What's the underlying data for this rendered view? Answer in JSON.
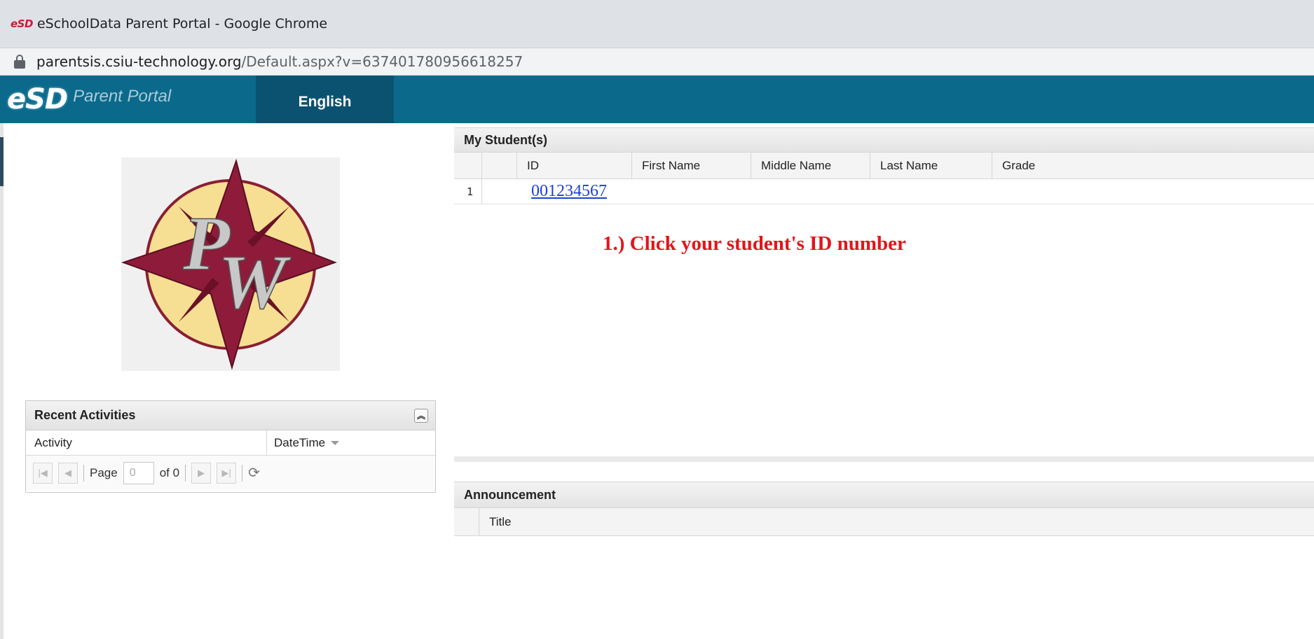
{
  "window": {
    "title_logo": "eSD",
    "title": "eSchoolData Parent Portal - Google Chrome",
    "url_host": "parentsis.csiu-technology.org",
    "url_path": "/Default.aspx?v=637401780956618257"
  },
  "header": {
    "brand_short": "eSD",
    "brand_name": "Parent Portal",
    "language": "English",
    "header_color": "#0b6a8c"
  },
  "logo": {
    "letters": "PW"
  },
  "recent_activities": {
    "title": "Recent Activities",
    "columns": [
      "Activity",
      "DateTime"
    ],
    "pager": {
      "page_label": "Page",
      "page_value": "0",
      "of_label": "of 0"
    }
  },
  "students": {
    "title": "My Student(s)",
    "columns": [
      "ID",
      "First Name",
      "Middle Name",
      "Last Name",
      "Grade"
    ],
    "rows": [
      {
        "num": "1",
        "id": "001234567",
        "first": "",
        "middle": "",
        "last": "",
        "grade": ""
      }
    ]
  },
  "instruction": {
    "text": "1.) Click your student's ID number",
    "color": "#e0161b"
  },
  "announcement": {
    "title": "Announcement",
    "columns": [
      "Title"
    ]
  }
}
